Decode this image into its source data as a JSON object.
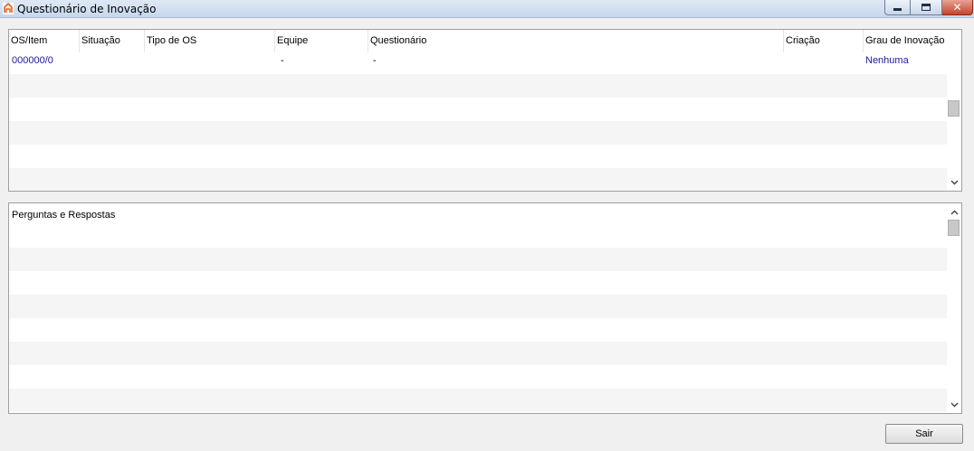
{
  "window": {
    "title": "Questionário de Inovação",
    "icon": "app-logo-icon",
    "controls": {
      "minimize": "minimize-icon",
      "maximize": "maximize-icon",
      "close": "close-icon"
    }
  },
  "grid": {
    "columns": [
      "OS/Item",
      "Situação",
      "Tipo de OS",
      "Equipe",
      "Questionário",
      "Criação",
      "Grau de Inovação"
    ],
    "rows": [
      {
        "os_item": "000000/0",
        "situacao": "",
        "tipo_os": "",
        "equipe": "-",
        "questionario": "-",
        "criacao": "",
        "grau": "Nenhuma"
      }
    ]
  },
  "qa": {
    "header": "Perguntas e Respostas"
  },
  "footer": {
    "exit_label": "Sair"
  },
  "colors": {
    "link": "#1a1a9c",
    "stripe": "#f5f5f5"
  }
}
